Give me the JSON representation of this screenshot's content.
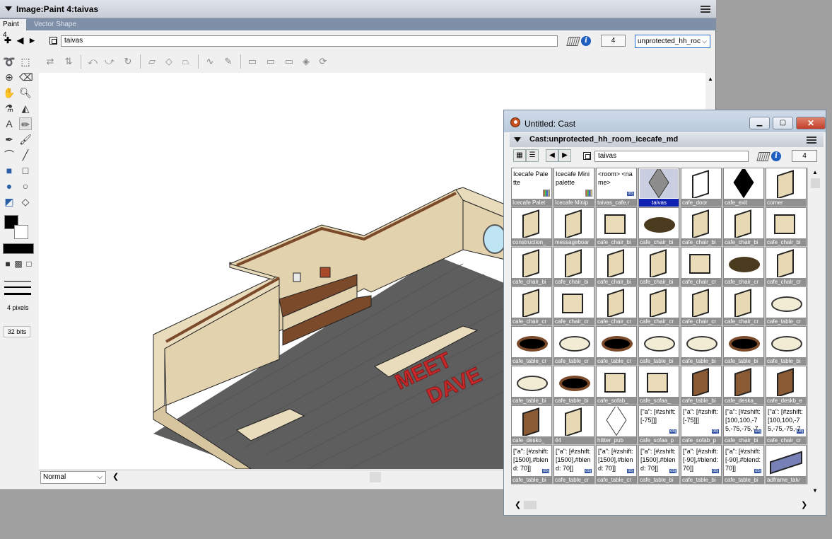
{
  "paint_window": {
    "title": "Image:Paint 4:taivas",
    "tabs": [
      "Paint 4",
      "Vector Shape"
    ],
    "member_name": "taivas",
    "member_number": "4",
    "cast_dropdown": "unprotected_hh_roc",
    "line_width_label": "4 pixels",
    "color_depth_label": "32 bits",
    "ink_mode": "Normal"
  },
  "artwork": {
    "sign_line1": "MEET",
    "sign_line2": "DAVE"
  },
  "cast_window": {
    "title": "Untitled: Cast",
    "header": "Cast:unprotected_hh_room_icecafe_md",
    "member_name": "taivas",
    "member_number": "4",
    "members": [
      {
        "label": "Icecafe Palet",
        "thumb_text": "Icecafe Palette",
        "kind": "palette"
      },
      {
        "label": "Icecafe Minip",
        "thumb_text": "Icecafe Minipalette",
        "kind": "palette"
      },
      {
        "label": "taivas_cafe.r",
        "thumb_text": "<room> <name>",
        "kind": "text"
      },
      {
        "label": "taivas",
        "thumb_text": "",
        "kind": "room",
        "selected": true
      },
      {
        "label": "cafe_door",
        "thumb_text": "",
        "kind": "door"
      },
      {
        "label": "cafe_exit",
        "thumb_text": "",
        "kind": "exit"
      },
      {
        "label": "corner",
        "thumb_text": "",
        "kind": "panel"
      },
      {
        "label": "construction_",
        "thumb_text": "",
        "kind": "panel"
      },
      {
        "label": "messageboar",
        "thumb_text": "",
        "kind": "panel"
      },
      {
        "label": "cafe_chair_bi",
        "thumb_text": "",
        "kind": "seat"
      },
      {
        "label": "cafe_chair_bi",
        "thumb_text": "",
        "kind": "dark"
      },
      {
        "label": "cafe_chair_bi",
        "thumb_text": "",
        "kind": "panel"
      },
      {
        "label": "cafe_chair_bi",
        "thumb_text": "",
        "kind": "panel"
      },
      {
        "label": "cafe_chair_bi",
        "thumb_text": "",
        "kind": "seat"
      },
      {
        "label": "cafe_chair_bi",
        "thumb_text": "",
        "kind": "panel"
      },
      {
        "label": "cafe_chair_bi",
        "thumb_text": "",
        "kind": "panel"
      },
      {
        "label": "cafe_chair_bi",
        "thumb_text": "",
        "kind": "panel"
      },
      {
        "label": "cafe_chair_bi",
        "thumb_text": "",
        "kind": "panel"
      },
      {
        "label": "cafe_chair_cr",
        "thumb_text": "",
        "kind": "seat"
      },
      {
        "label": "cafe_chair_cr",
        "thumb_text": "",
        "kind": "dark"
      },
      {
        "label": "cafe_chair_cr",
        "thumb_text": "",
        "kind": "panel"
      },
      {
        "label": "cafe_chair_cr",
        "thumb_text": "",
        "kind": "panel"
      },
      {
        "label": "cafe_chair_cr",
        "thumb_text": "",
        "kind": "seat"
      },
      {
        "label": "cafe_chair_cr",
        "thumb_text": "",
        "kind": "panel"
      },
      {
        "label": "cafe_chair_cr",
        "thumb_text": "",
        "kind": "panel"
      },
      {
        "label": "cafe_chair_cr",
        "thumb_text": "",
        "kind": "panel"
      },
      {
        "label": "cafe_chair_cr",
        "thumb_text": "",
        "kind": "panel"
      },
      {
        "label": "cafe_table_cr",
        "thumb_text": "",
        "kind": "table"
      },
      {
        "label": "cafe_table_cr",
        "thumb_text": "",
        "kind": "darktable"
      },
      {
        "label": "cafe_table_cr",
        "thumb_text": "",
        "kind": "table"
      },
      {
        "label": "cafe_table_cr",
        "thumb_text": "",
        "kind": "darktable"
      },
      {
        "label": "cafe_table_bi",
        "thumb_text": "",
        "kind": "table"
      },
      {
        "label": "cafe_table_bi",
        "thumb_text": "",
        "kind": "table"
      },
      {
        "label": "cafe_table_bi",
        "thumb_text": "",
        "kind": "darktable"
      },
      {
        "label": "cafe_table_bi",
        "thumb_text": "",
        "kind": "table"
      },
      {
        "label": "cafe_table_bi",
        "thumb_text": "",
        "kind": "table"
      },
      {
        "label": "cafe_table_bi",
        "thumb_text": "",
        "kind": "darktable"
      },
      {
        "label": "cafe_sofab_",
        "thumb_text": "",
        "kind": "seat"
      },
      {
        "label": "cafe_sofaa_",
        "thumb_text": "",
        "kind": "seat"
      },
      {
        "label": "cafe_table_bi",
        "thumb_text": "",
        "kind": "wood"
      },
      {
        "label": "cafe_deska_",
        "thumb_text": "",
        "kind": "wood"
      },
      {
        "label": "cafe_deskb_e",
        "thumb_text": "",
        "kind": "wood"
      },
      {
        "label": "cafe_desko_",
        "thumb_text": "",
        "kind": "wood"
      },
      {
        "label": "44",
        "thumb_text": "",
        "kind": "panel"
      },
      {
        "label": "hiliter_pub",
        "thumb_text": "",
        "kind": "hiliter"
      },
      {
        "label": "cafe_sofaa_p",
        "thumb_text": "[\"a\": [#zshift: [-75]]]",
        "kind": "text"
      },
      {
        "label": "cafe_sofab_p",
        "thumb_text": "[\"a\": [#zshift: [-75]]]",
        "kind": "text"
      },
      {
        "label": "cafe_chair_bi",
        "thumb_text": "[\"a\": [#zshift: [100,100,-75,-75,-75,-7",
        "kind": "text"
      },
      {
        "label": "cafe_chair_cr",
        "thumb_text": "[\"a\": [#zshift: [100,100,-75,-75,-75,-7",
        "kind": "text"
      },
      {
        "label": "cafe_table_bi",
        "thumb_text": "[\"a\": [#zshift: [1500],#blend: 70]]",
        "kind": "text"
      },
      {
        "label": "cafe_table_cr",
        "thumb_text": "[\"a\": [#zshift: [1500],#blend: 70]]",
        "kind": "text"
      },
      {
        "label": "cafe_table_cr",
        "thumb_text": "[\"a\": [#zshift: [1500],#blend: 70]]",
        "kind": "text"
      },
      {
        "label": "cafe_table_bi",
        "thumb_text": "[\"a\": [#zshift: [1500],#blend: 70]]",
        "kind": "text"
      },
      {
        "label": "cafe_table_bi",
        "thumb_text": "[\"a\": [#zshift: [-90],#blend: 70]]",
        "kind": "text"
      },
      {
        "label": "cafe_table_bi",
        "thumb_text": "[\"a\": [#zshift: [-90],#blend: 70]]",
        "kind": "text"
      },
      {
        "label": "adframe_taiv",
        "thumb_text": "",
        "kind": "adframe"
      }
    ]
  },
  "colors": {
    "selection": "#1020b0",
    "label_bg": "#909090",
    "floor": "#5e5e5e",
    "wall": "#e9dcbc",
    "wall_trim": "#7a4a2a",
    "sign_red": "#c8282a"
  }
}
